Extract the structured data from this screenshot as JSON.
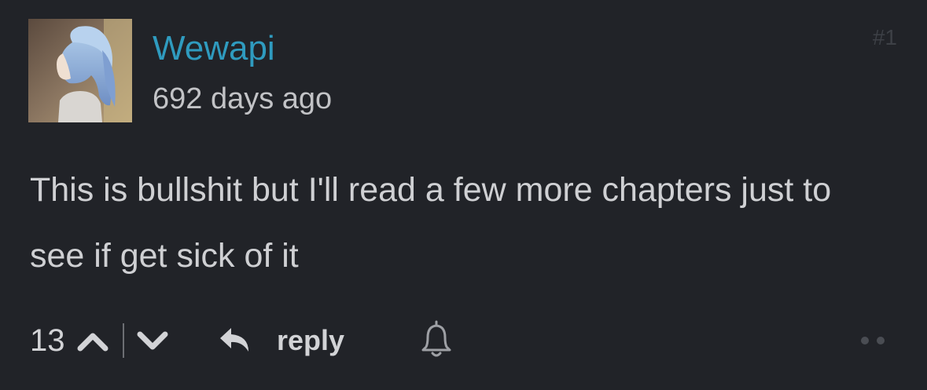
{
  "comment": {
    "username": "Wewapi",
    "timestamp": "692 days ago",
    "number": "#1",
    "body": "This is bullshit but I'll read a few more chapters just to see if get sick of it",
    "votes": "13",
    "reply_label": "reply"
  },
  "colors": {
    "background": "#212328",
    "username": "#2f9bbf",
    "text": "#cfd0d3",
    "muted": "#3d4046"
  },
  "icons": {
    "avatar": "anime-character-avatar",
    "upvote": "chevron-up-icon",
    "downvote": "chevron-down-icon",
    "reply": "reply-arrow-icon",
    "notify": "bell-icon",
    "more": "more-dots-icon"
  }
}
